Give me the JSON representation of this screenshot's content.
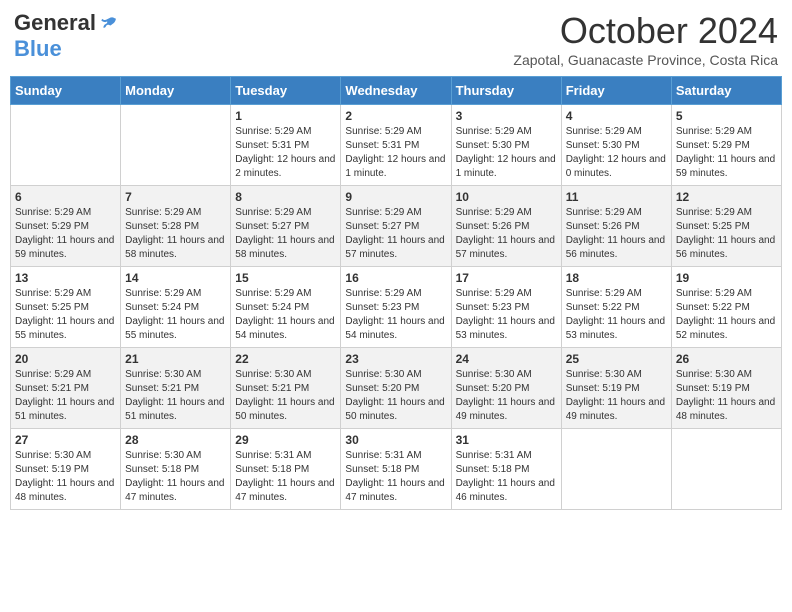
{
  "header": {
    "logo_general": "General",
    "logo_blue": "Blue",
    "month_title": "October 2024",
    "subtitle": "Zapotal, Guanacaste Province, Costa Rica"
  },
  "days_of_week": [
    "Sunday",
    "Monday",
    "Tuesday",
    "Wednesday",
    "Thursday",
    "Friday",
    "Saturday"
  ],
  "weeks": [
    [
      {
        "day": "",
        "info": ""
      },
      {
        "day": "",
        "info": ""
      },
      {
        "day": "1",
        "info": "Sunrise: 5:29 AM\nSunset: 5:31 PM\nDaylight: 12 hours and 2 minutes."
      },
      {
        "day": "2",
        "info": "Sunrise: 5:29 AM\nSunset: 5:31 PM\nDaylight: 12 hours and 1 minute."
      },
      {
        "day": "3",
        "info": "Sunrise: 5:29 AM\nSunset: 5:30 PM\nDaylight: 12 hours and 1 minute."
      },
      {
        "day": "4",
        "info": "Sunrise: 5:29 AM\nSunset: 5:30 PM\nDaylight: 12 hours and 0 minutes."
      },
      {
        "day": "5",
        "info": "Sunrise: 5:29 AM\nSunset: 5:29 PM\nDaylight: 11 hours and 59 minutes."
      }
    ],
    [
      {
        "day": "6",
        "info": "Sunrise: 5:29 AM\nSunset: 5:29 PM\nDaylight: 11 hours and 59 minutes."
      },
      {
        "day": "7",
        "info": "Sunrise: 5:29 AM\nSunset: 5:28 PM\nDaylight: 11 hours and 58 minutes."
      },
      {
        "day": "8",
        "info": "Sunrise: 5:29 AM\nSunset: 5:27 PM\nDaylight: 11 hours and 58 minutes."
      },
      {
        "day": "9",
        "info": "Sunrise: 5:29 AM\nSunset: 5:27 PM\nDaylight: 11 hours and 57 minutes."
      },
      {
        "day": "10",
        "info": "Sunrise: 5:29 AM\nSunset: 5:26 PM\nDaylight: 11 hours and 57 minutes."
      },
      {
        "day": "11",
        "info": "Sunrise: 5:29 AM\nSunset: 5:26 PM\nDaylight: 11 hours and 56 minutes."
      },
      {
        "day": "12",
        "info": "Sunrise: 5:29 AM\nSunset: 5:25 PM\nDaylight: 11 hours and 56 minutes."
      }
    ],
    [
      {
        "day": "13",
        "info": "Sunrise: 5:29 AM\nSunset: 5:25 PM\nDaylight: 11 hours and 55 minutes."
      },
      {
        "day": "14",
        "info": "Sunrise: 5:29 AM\nSunset: 5:24 PM\nDaylight: 11 hours and 55 minutes."
      },
      {
        "day": "15",
        "info": "Sunrise: 5:29 AM\nSunset: 5:24 PM\nDaylight: 11 hours and 54 minutes."
      },
      {
        "day": "16",
        "info": "Sunrise: 5:29 AM\nSunset: 5:23 PM\nDaylight: 11 hours and 54 minutes."
      },
      {
        "day": "17",
        "info": "Sunrise: 5:29 AM\nSunset: 5:23 PM\nDaylight: 11 hours and 53 minutes."
      },
      {
        "day": "18",
        "info": "Sunrise: 5:29 AM\nSunset: 5:22 PM\nDaylight: 11 hours and 53 minutes."
      },
      {
        "day": "19",
        "info": "Sunrise: 5:29 AM\nSunset: 5:22 PM\nDaylight: 11 hours and 52 minutes."
      }
    ],
    [
      {
        "day": "20",
        "info": "Sunrise: 5:29 AM\nSunset: 5:21 PM\nDaylight: 11 hours and 51 minutes."
      },
      {
        "day": "21",
        "info": "Sunrise: 5:30 AM\nSunset: 5:21 PM\nDaylight: 11 hours and 51 minutes."
      },
      {
        "day": "22",
        "info": "Sunrise: 5:30 AM\nSunset: 5:21 PM\nDaylight: 11 hours and 50 minutes."
      },
      {
        "day": "23",
        "info": "Sunrise: 5:30 AM\nSunset: 5:20 PM\nDaylight: 11 hours and 50 minutes."
      },
      {
        "day": "24",
        "info": "Sunrise: 5:30 AM\nSunset: 5:20 PM\nDaylight: 11 hours and 49 minutes."
      },
      {
        "day": "25",
        "info": "Sunrise: 5:30 AM\nSunset: 5:19 PM\nDaylight: 11 hours and 49 minutes."
      },
      {
        "day": "26",
        "info": "Sunrise: 5:30 AM\nSunset: 5:19 PM\nDaylight: 11 hours and 48 minutes."
      }
    ],
    [
      {
        "day": "27",
        "info": "Sunrise: 5:30 AM\nSunset: 5:19 PM\nDaylight: 11 hours and 48 minutes."
      },
      {
        "day": "28",
        "info": "Sunrise: 5:30 AM\nSunset: 5:18 PM\nDaylight: 11 hours and 47 minutes."
      },
      {
        "day": "29",
        "info": "Sunrise: 5:31 AM\nSunset: 5:18 PM\nDaylight: 11 hours and 47 minutes."
      },
      {
        "day": "30",
        "info": "Sunrise: 5:31 AM\nSunset: 5:18 PM\nDaylight: 11 hours and 47 minutes."
      },
      {
        "day": "31",
        "info": "Sunrise: 5:31 AM\nSunset: 5:18 PM\nDaylight: 11 hours and 46 minutes."
      },
      {
        "day": "",
        "info": ""
      },
      {
        "day": "",
        "info": ""
      }
    ]
  ]
}
